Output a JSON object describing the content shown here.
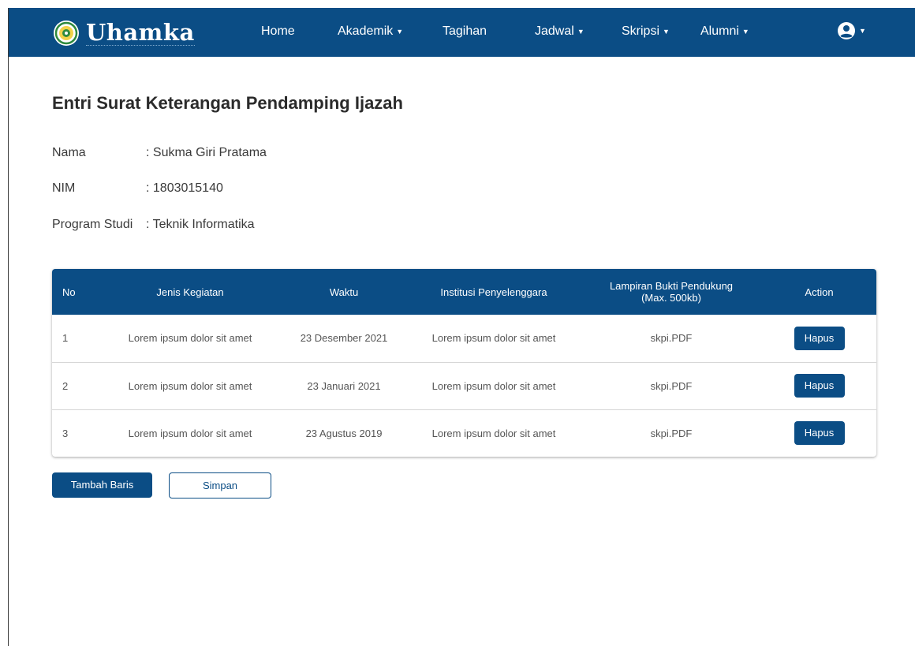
{
  "brand": {
    "name": "Uhamka"
  },
  "nav": {
    "home": "Home",
    "akademik": "Akademik",
    "tagihan": "Tagihan",
    "jadwal": "Jadwal",
    "skripsi": "Skripsi",
    "alumni": "Alumni"
  },
  "page": {
    "title": "Entri Surat Keterangan Pendamping Ijazah"
  },
  "student": {
    "nama_label": "Nama",
    "nama_value": ": Sukma Giri Pratama",
    "nim_label": "NIM",
    "nim_value": ": 1803015140",
    "prodi_label": "Program Studi",
    "prodi_value": ": Teknik Informatika"
  },
  "table": {
    "headers": {
      "no": "No",
      "jenis": "Jenis Kegiatan",
      "waktu": "Waktu",
      "institusi": "Institusi Penyelenggara",
      "lampiran_1": "Lampiran Bukti Pendukung",
      "lampiran_2": "(Max. 500kb)",
      "action": "Action"
    },
    "rows": [
      {
        "no": "1",
        "jenis": "Lorem ipsum dolor sit amet",
        "waktu": "23 Desember 2021",
        "institusi": "Lorem ipsum dolor sit amet",
        "lampiran": "skpi.PDF",
        "action": "Hapus"
      },
      {
        "no": "2",
        "jenis": "Lorem ipsum dolor sit amet",
        "waktu": "23 Januari 2021",
        "institusi": "Lorem ipsum dolor sit amet",
        "lampiran": "skpi.PDF",
        "action": "Hapus"
      },
      {
        "no": "3",
        "jenis": "Lorem ipsum dolor sit amet",
        "waktu": "23 Agustus 2019",
        "institusi": "Lorem ipsum dolor sit amet",
        "lampiran": "skpi.PDF",
        "action": "Hapus"
      }
    ]
  },
  "buttons": {
    "tambah": "Tambah Baris",
    "simpan": "Simpan"
  },
  "icons": {
    "logo": "university-seal-icon",
    "user": "user-circle-icon",
    "caret": "caret-down-icon"
  },
  "colors": {
    "primary": "#0b4d85",
    "white": "#ffffff",
    "text": "#333333"
  }
}
